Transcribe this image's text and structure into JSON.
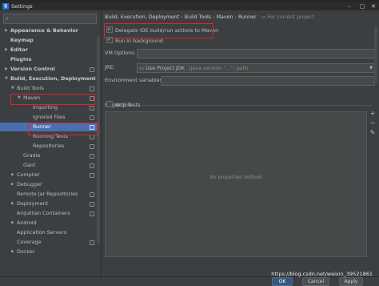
{
  "window": {
    "title": "Settings",
    "app_icon": "IJ"
  },
  "search": {
    "placeholder": ""
  },
  "tree": [
    {
      "label": "Appearance & Behavior",
      "bold": true,
      "arrow": "▶",
      "level": 0
    },
    {
      "label": "Keymap",
      "bold": true,
      "arrow": "",
      "level": 0
    },
    {
      "label": "Editor",
      "bold": true,
      "arrow": "▶",
      "level": 0
    },
    {
      "label": "Plugins",
      "bold": true,
      "arrow": "",
      "level": 0
    },
    {
      "label": "Version Control",
      "bold": true,
      "arrow": "▶",
      "level": 0,
      "copy": true
    },
    {
      "label": "Build, Execution, Deployment",
      "bold": true,
      "arrow": "▼",
      "level": 0
    },
    {
      "label": "Build Tools",
      "arrow": "▼",
      "level": 1,
      "copy": true
    },
    {
      "label": "Maven",
      "arrow": "▼",
      "level": 2,
      "copy": true
    },
    {
      "label": "Importing",
      "arrow": "",
      "level": 3,
      "copy": true
    },
    {
      "label": "Ignored Files",
      "arrow": "",
      "level": 3,
      "copy": true
    },
    {
      "label": "Runner",
      "arrow": "",
      "level": 3,
      "copy": true,
      "selected": true
    },
    {
      "label": "Running Tests",
      "arrow": "",
      "level": 3,
      "copy": true
    },
    {
      "label": "Repositories",
      "arrow": "",
      "level": 3,
      "copy": true
    },
    {
      "label": "Gradle",
      "arrow": "",
      "level": 2,
      "copy": true
    },
    {
      "label": "Gant",
      "arrow": "",
      "level": 2,
      "copy": true
    },
    {
      "label": "Compiler",
      "arrow": "▶",
      "level": 1,
      "copy": true
    },
    {
      "label": "Debugger",
      "arrow": "▶",
      "level": 1
    },
    {
      "label": "Remote Jar Repositories",
      "arrow": "",
      "level": 1,
      "copy": true
    },
    {
      "label": "Deployment",
      "arrow": "▶",
      "level": 1,
      "copy": true
    },
    {
      "label": "Arquillian Containers",
      "arrow": "",
      "level": 1,
      "copy": true
    },
    {
      "label": "Android",
      "arrow": "▶",
      "level": 1
    },
    {
      "label": "Application Servers",
      "arrow": "",
      "level": 1
    },
    {
      "label": "Coverage",
      "arrow": "",
      "level": 1,
      "copy": true
    },
    {
      "label": "Docker",
      "arrow": "▶",
      "level": 1
    }
  ],
  "breadcrumb": {
    "items": [
      "Build, Execution, Deployment",
      "Build Tools",
      "Maven",
      "Runner"
    ],
    "separator": "›",
    "for_current_project": "For current project"
  },
  "options": {
    "delegate": {
      "label": "Delegate IDE build/run actions to Maven",
      "checked": true
    },
    "run_in_background": {
      "label": "Run in background",
      "checked": true
    }
  },
  "vm_options": {
    "label": "VM Options:",
    "value": ""
  },
  "jre": {
    "label": "JRE:",
    "value": "Use Project JDK",
    "detail": "(java version \"…\", path:"
  },
  "env_vars": {
    "label": "Environment variables:",
    "value": ""
  },
  "properties": {
    "label": "Properties:",
    "skip_tests": {
      "label": "Skip Tests",
      "checked": false
    },
    "empty_text": "No properties defined",
    "tools": [
      "+",
      "−",
      "✎"
    ]
  },
  "buttons": {
    "ok": "OK",
    "cancel": "Cancel",
    "apply": "Apply"
  },
  "watermark": "https://blog.csdn.net/weixin_39521861",
  "colors": {
    "accent": "#4b6eaf",
    "highlight": "#e0242a",
    "background": "#3c3f41"
  }
}
